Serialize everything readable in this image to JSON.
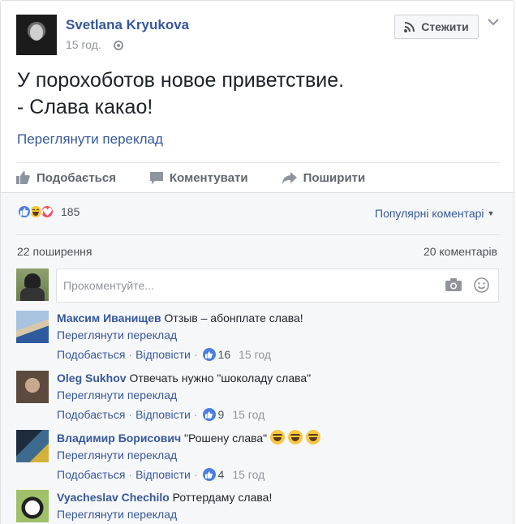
{
  "post": {
    "author": "Svetlana Kryukova",
    "time": "15 год.",
    "follow_label": "Стежити",
    "text_line1": "У порохоботов новое приветствие.",
    "text_line2": "- Слава какао!",
    "see_translation": "Переглянути переклад"
  },
  "actions": {
    "like": "Подобається",
    "comment": "Коментувати",
    "share": "Поширити"
  },
  "reactions": {
    "count": "185",
    "sort_label": "Популярні коментарі"
  },
  "stats": {
    "shares": "22 поширення",
    "comments": "20 коментарів"
  },
  "composer": {
    "placeholder": "Прокоментуйте..."
  },
  "comments": [
    {
      "author": "Максим Иванищев",
      "text": "Отзыв – абонплате слава!",
      "translate": "Переглянути переклад",
      "like": "Подобається",
      "reply": "Відповісти",
      "likes": "16",
      "time": "15 год"
    },
    {
      "author": "Oleg Sukhov",
      "text": "Отвечать нужно \"шоколаду слава\"",
      "translate": "Переглянути переклад",
      "like": "Подобається",
      "reply": "Відповісти",
      "likes": "9",
      "time": "15 год"
    },
    {
      "author": "Владимир Борисович",
      "text": "\"Рошену слава\"",
      "translate": "Переглянути переклад",
      "like": "Подобається",
      "reply": "Відповісти",
      "likes": "4",
      "time": "15 год"
    },
    {
      "author": "Vyacheslav Chechilo",
      "text": "Роттердаму слава!",
      "translate": "Переглянути переклад"
    }
  ],
  "colors": {
    "link": "#365899",
    "like_blue": "#4a7fe0",
    "haha_yellow": "#f7c843",
    "love_red": "#f25268"
  }
}
